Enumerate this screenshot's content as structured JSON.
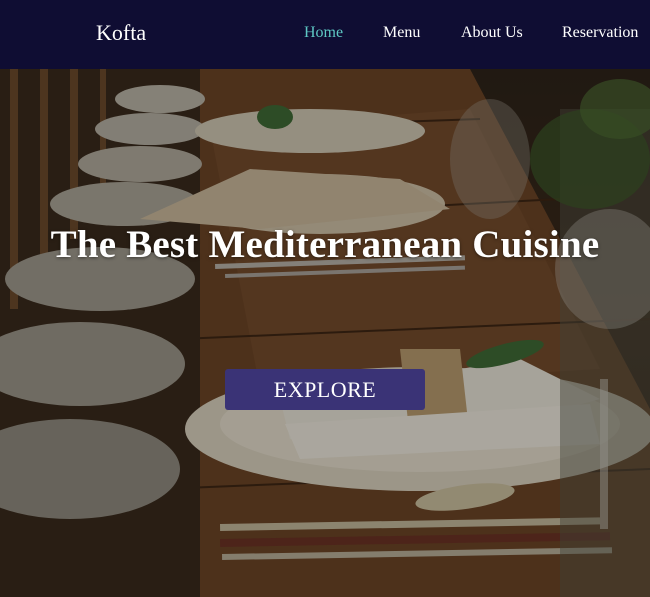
{
  "brand": "Kofta",
  "nav": {
    "home": "Home",
    "menu": "Menu",
    "about": "About Us",
    "reservation": "Reservation"
  },
  "hero": {
    "title": "The Best Mediterranean Cuisine",
    "button": "EXPLORE"
  },
  "colors": {
    "navbar_bg": "#0f0d33",
    "active_link": "#5ec8c4",
    "button_bg": "#3a3376"
  }
}
